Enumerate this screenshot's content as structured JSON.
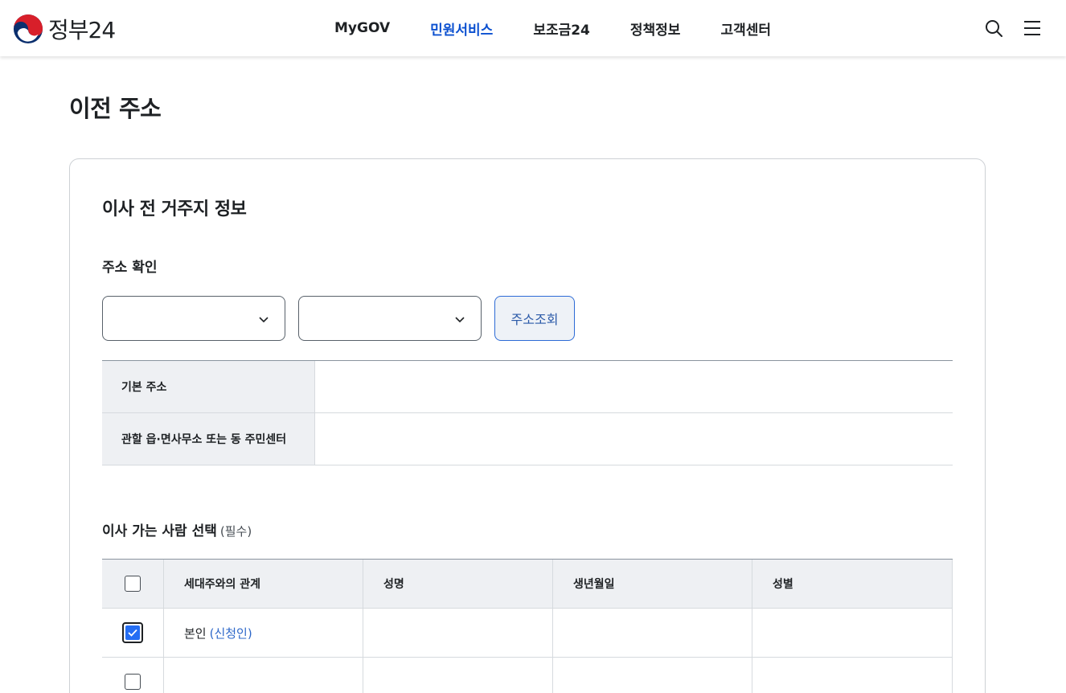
{
  "header": {
    "logo_text": "정부24",
    "nav": [
      "MyGOV",
      "민원서비스",
      "보조금24",
      "정책정보",
      "고객센터"
    ],
    "active_nav": "민원서비스"
  },
  "page": {
    "title": "이전 주소"
  },
  "section": {
    "title": "이사 전 거주지 정보",
    "address_check": {
      "label": "주소 확인",
      "select_1_value": "",
      "select_2_value": "",
      "lookup_button": "주소조회"
    },
    "address_table": [
      {
        "label": "기본 주소",
        "value": ""
      },
      {
        "label": "관할 읍·면사무소 또는 동 주민센터",
        "value": ""
      }
    ],
    "movers": {
      "title": "이사 가는 사람 선택",
      "required": "(필수)",
      "columns": [
        "세대주와의 관계",
        "성명",
        "생년월일",
        "성별"
      ],
      "rows": [
        {
          "checked": true,
          "relation": "본인",
          "relation_note": "(신청인)",
          "name": "",
          "birth": "",
          "sex": ""
        },
        {
          "checked": false,
          "relation": "",
          "relation_note": "",
          "name": "",
          "birth": "",
          "sex": ""
        }
      ]
    }
  },
  "colors": {
    "accent": "#256ef4",
    "nav_active": "#0b50d0",
    "link": "#2e68c9"
  }
}
